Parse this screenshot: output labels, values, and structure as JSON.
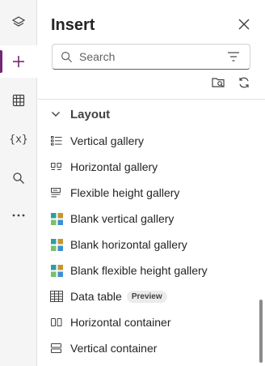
{
  "panel": {
    "title": "Insert",
    "search": {
      "placeholder": "Search",
      "value": ""
    }
  },
  "rail": {
    "items": [
      {
        "name": "tree-view",
        "icon": "layers-icon"
      },
      {
        "name": "insert",
        "icon": "plus-icon",
        "active": true
      },
      {
        "name": "data",
        "icon": "table-icon"
      },
      {
        "name": "variables",
        "icon": "variables-icon",
        "label": "{x}"
      },
      {
        "name": "search",
        "icon": "search-icon"
      },
      {
        "name": "more",
        "icon": "more-icon"
      }
    ],
    "accent_color": "#742774"
  },
  "section": {
    "label": "Layout",
    "items": [
      {
        "label": "Vertical gallery",
        "icon": "vertical-gallery-icon"
      },
      {
        "label": "Horizontal gallery",
        "icon": "horizontal-gallery-icon"
      },
      {
        "label": "Flexible height gallery",
        "icon": "flexible-height-gallery-icon"
      },
      {
        "label": "Blank vertical gallery",
        "icon": "blank-gallery-icon"
      },
      {
        "label": "Blank horizontal gallery",
        "icon": "blank-gallery-icon"
      },
      {
        "label": "Blank flexible height gallery",
        "icon": "blank-gallery-icon"
      },
      {
        "label": "Data table",
        "icon": "data-table-icon",
        "badge": "Preview"
      },
      {
        "label": "Horizontal container",
        "icon": "horizontal-container-icon"
      },
      {
        "label": "Vertical container",
        "icon": "vertical-container-icon"
      }
    ]
  }
}
